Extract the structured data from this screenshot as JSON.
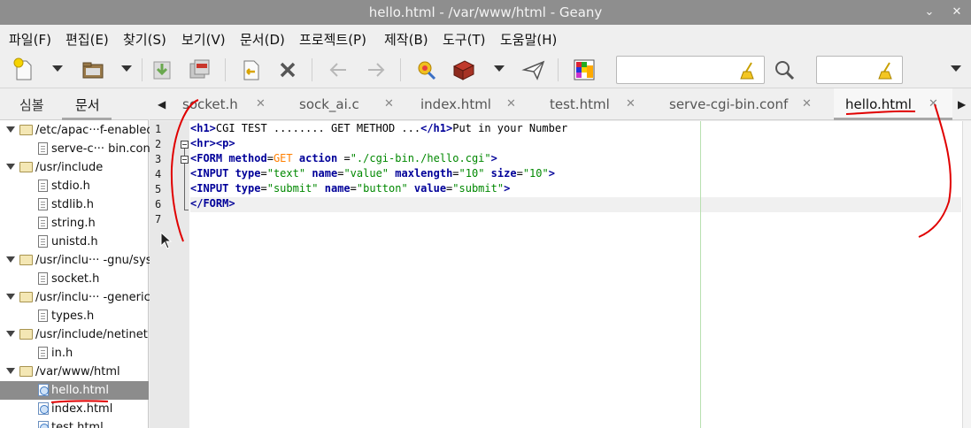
{
  "window": {
    "title": "hello.html - /var/www/html - Geany",
    "minimize_glyph": "⌄",
    "close_glyph": "✕"
  },
  "menu": [
    "파일(F)",
    "편집(E)",
    "찾기(S)",
    "보기(V)",
    "문서(D)",
    "프로젝트(P)",
    "제작(B)",
    "도구(T)",
    "도움말(H)"
  ],
  "toolbar": {
    "icons": [
      "new-file-icon",
      "open-file-icon",
      "save-icon",
      "save-all-icon",
      "revert-icon",
      "close-icon",
      "back-icon",
      "forward-icon",
      "compile-icon",
      "build-icon",
      "execute-icon",
      "color-chooser-icon",
      "search-icon"
    ],
    "search_value": "",
    "goto_value": ""
  },
  "sidebar": {
    "tabs": [
      "심볼",
      "문서"
    ],
    "active_tab": "문서",
    "tree": [
      {
        "kind": "folder",
        "label": "/etc/apac···f-enabled"
      },
      {
        "kind": "file",
        "label": "serve-c··· bin.conf"
      },
      {
        "kind": "folder",
        "label": "/usr/include"
      },
      {
        "kind": "file",
        "label": "stdio.h"
      },
      {
        "kind": "file",
        "label": "stdlib.h"
      },
      {
        "kind": "file",
        "label": "string.h"
      },
      {
        "kind": "file",
        "label": "unistd.h"
      },
      {
        "kind": "folder",
        "label": "/usr/inclu···  -gnu/sys"
      },
      {
        "kind": "file",
        "label": "socket.h"
      },
      {
        "kind": "folder",
        "label": "/usr/inclu···  -generic"
      },
      {
        "kind": "file",
        "label": "types.h"
      },
      {
        "kind": "folder",
        "label": "/usr/include/netinet"
      },
      {
        "kind": "file",
        "label": "in.h"
      },
      {
        "kind": "folder",
        "label": "/var/www/html"
      },
      {
        "kind": "html",
        "label": "hello.html",
        "selected": true
      },
      {
        "kind": "html",
        "label": "index.html"
      },
      {
        "kind": "html",
        "label": "test.html"
      }
    ]
  },
  "tabs": [
    {
      "label": "socket.h",
      "close": "✕"
    },
    {
      "label": "sock_ai.c",
      "close": "✕"
    },
    {
      "label": "index.html",
      "close": "✕"
    },
    {
      "label": "test.html",
      "close": "✕"
    },
    {
      "label": "serve-cgi-bin.conf",
      "close": "✕"
    },
    {
      "label": "hello.html",
      "close": "✕",
      "active": true
    }
  ],
  "tab_nav": {
    "left": "◀",
    "right": "▶"
  },
  "editor": {
    "line_numbers": [
      "1",
      "2",
      "3",
      "4",
      "5",
      "6",
      "7"
    ],
    "current_line": 6,
    "lines": [
      [
        {
          "t": "tag",
          "v": "<h1>"
        },
        {
          "t": "text",
          "v": "CGI TEST ........ GET METHOD ..."
        },
        {
          "t": "tag",
          "v": "</h1>"
        },
        {
          "t": "text",
          "v": "Put in your Number"
        }
      ],
      [
        {
          "t": "tag",
          "v": "<hr><p>"
        }
      ],
      [
        {
          "t": "tag",
          "v": "<FORM "
        },
        {
          "t": "attr",
          "v": "method"
        },
        {
          "t": "text",
          "v": "="
        },
        {
          "t": "kw",
          "v": "GET"
        },
        {
          "t": "text",
          "v": " "
        },
        {
          "t": "attr",
          "v": "action"
        },
        {
          "t": "text",
          "v": " ="
        },
        {
          "t": "str",
          "v": "\"./cgi-bin./hello.cgi\""
        },
        {
          "t": "tag",
          "v": ">"
        }
      ],
      [
        {
          "t": "tag",
          "v": "<INPUT "
        },
        {
          "t": "attr",
          "v": "type"
        },
        {
          "t": "text",
          "v": "="
        },
        {
          "t": "str",
          "v": "\"text\""
        },
        {
          "t": "text",
          "v": " "
        },
        {
          "t": "attr",
          "v": "name"
        },
        {
          "t": "text",
          "v": "="
        },
        {
          "t": "str",
          "v": "\"value\""
        },
        {
          "t": "text",
          "v": " "
        },
        {
          "t": "attr",
          "v": "maxlength"
        },
        {
          "t": "text",
          "v": "="
        },
        {
          "t": "str",
          "v": "\"10\""
        },
        {
          "t": "text",
          "v": " "
        },
        {
          "t": "attr",
          "v": "size"
        },
        {
          "t": "text",
          "v": "="
        },
        {
          "t": "str",
          "v": "\"10\""
        },
        {
          "t": "tag",
          "v": ">"
        }
      ],
      [
        {
          "t": "tag",
          "v": "<INPUT "
        },
        {
          "t": "attr",
          "v": "type"
        },
        {
          "t": "text",
          "v": "="
        },
        {
          "t": "str",
          "v": "\"submit\""
        },
        {
          "t": "text",
          "v": " "
        },
        {
          "t": "attr",
          "v": "name"
        },
        {
          "t": "text",
          "v": "="
        },
        {
          "t": "str",
          "v": "\"button\""
        },
        {
          "t": "text",
          "v": " "
        },
        {
          "t": "attr",
          "v": "value"
        },
        {
          "t": "text",
          "v": "="
        },
        {
          "t": "str",
          "v": "\"submit\""
        },
        {
          "t": "tag",
          "v": ">"
        }
      ],
      [
        {
          "t": "tag",
          "v": "</FORM>"
        }
      ],
      []
    ]
  },
  "colors": {
    "tag": "#000099",
    "string": "#008800",
    "keyword": "#ff7f00",
    "annotation": "#e00000",
    "selection": "#8c8c8c"
  }
}
